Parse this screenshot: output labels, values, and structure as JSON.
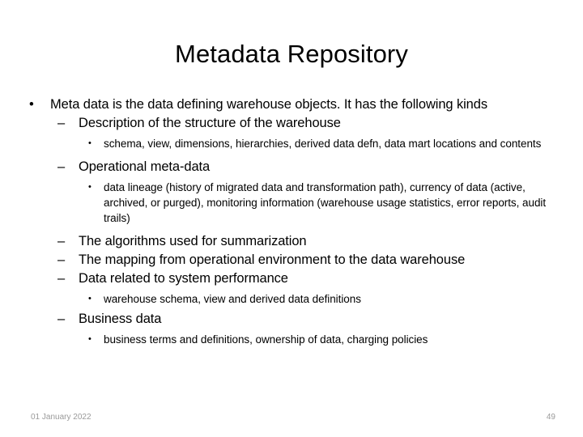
{
  "slide": {
    "title": "Metadata Repository",
    "bullet_glyph_level1": "•",
    "bullet_glyph_level2": "–",
    "bullet_glyph_level3": "•",
    "content": [
      {
        "level": 1,
        "text": "Meta data is the data defining warehouse objects.  It has the following kinds"
      },
      {
        "level": 2,
        "text": "Description of the structure of the warehouse"
      },
      {
        "level": 3,
        "text": "schema, view, dimensions, hierarchies, derived data defn, data mart locations and contents"
      },
      {
        "level": 2,
        "text": "Operational meta-data"
      },
      {
        "level": 3,
        "text": "data lineage (history of migrated data and transformation path), currency of data (active, archived, or purged), monitoring information (warehouse usage statistics, error reports, audit trails)"
      },
      {
        "level": 2,
        "text": "The algorithms used for summarization"
      },
      {
        "level": 2,
        "text": "The mapping from operational environment to the data warehouse"
      },
      {
        "level": 2,
        "text": "Data related to system performance"
      },
      {
        "level": 3,
        "text": "warehouse schema, view and derived data definitions"
      },
      {
        "level": 2,
        "text": "Business data"
      },
      {
        "level": 3,
        "text": "business terms and definitions, ownership of data, charging policies"
      }
    ]
  },
  "footer": {
    "date": "01 January 2022",
    "page_number": "49",
    "text_color": "#9a9a9a"
  },
  "colors": {
    "background": "#ffffff",
    "text": "#000000"
  }
}
